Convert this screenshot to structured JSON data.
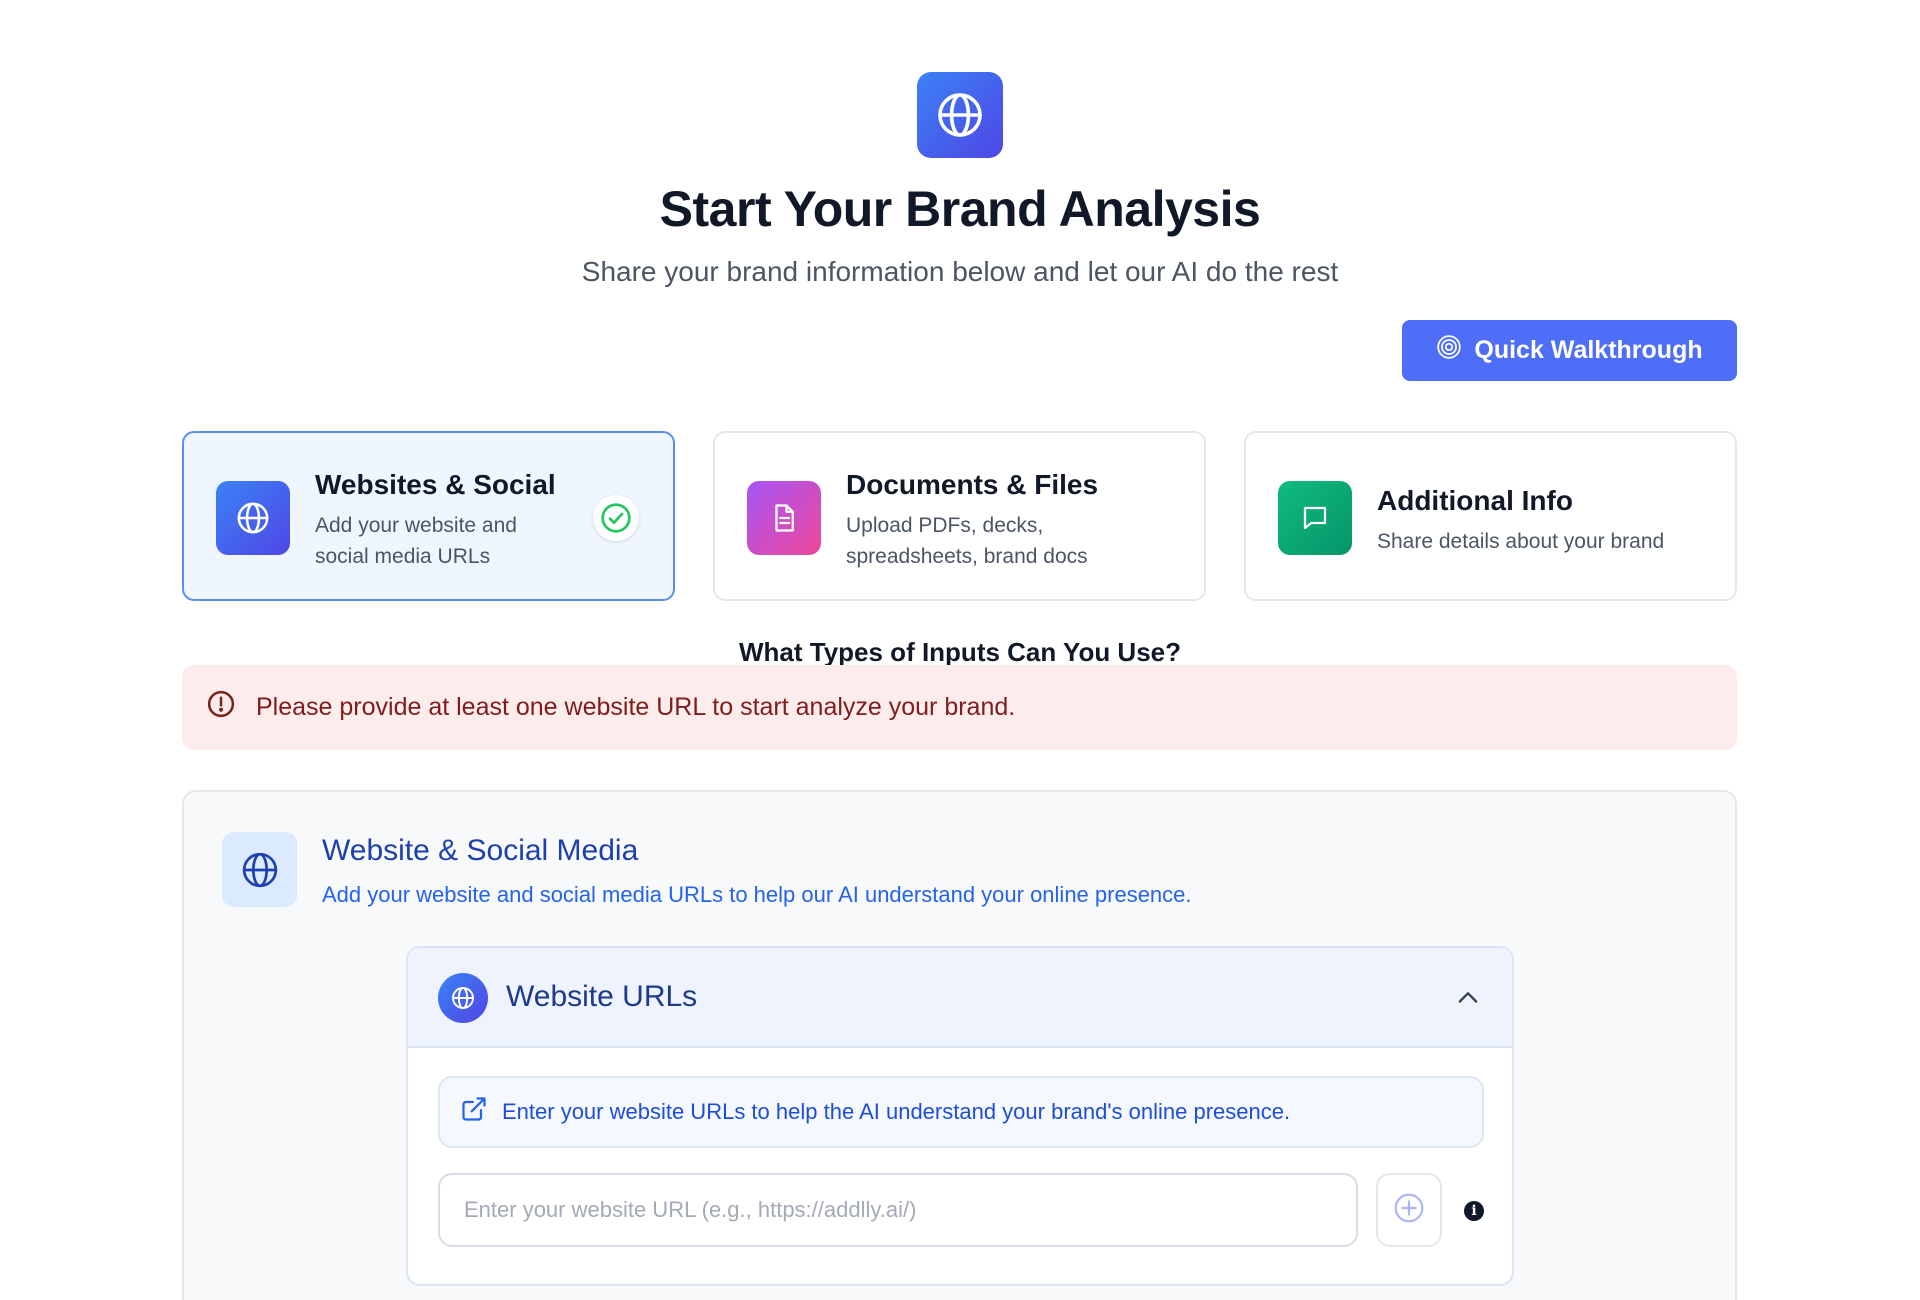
{
  "header": {
    "icon": "globe-icon",
    "title": "Start Your Brand Analysis",
    "subtitle": "Share your brand information below and let our AI do the rest",
    "walkthrough_label": "Quick Walkthrough",
    "walkthrough_icon": "target-icon"
  },
  "steps": [
    {
      "title": "Websites & Social",
      "desc_line1": "Add your website and",
      "desc_line2": "social media URLs",
      "icon": "globe-icon",
      "active": true,
      "completed": true
    },
    {
      "title": "Documents & Files",
      "desc_line1": "Upload PDFs, decks,",
      "desc_line2": "spreadsheets, brand docs",
      "icon": "document-icon",
      "active": false
    },
    {
      "title": "Additional Info",
      "desc_line1": "Share details about your brand",
      "icon": "chat-icon",
      "active": false
    }
  ],
  "inputs_heading": "What Types of Inputs Can You Use?",
  "alert": {
    "text": "Please provide at least one website URL to start analyze your brand.",
    "icon": "alert-circle-icon"
  },
  "section": {
    "title": "Website & Social Media",
    "desc": "Add your website and social media URLs to help our AI understand your online presence.",
    "urls_panel": {
      "title": "Website URLs",
      "hint": "Enter your website URLs to help the AI understand your brand's online presence.",
      "input_value": "",
      "input_placeholder": "Enter your website URL (e.g., https://addlly.ai/)",
      "info_glyph": "i"
    }
  },
  "colors": {
    "primary": "#4f6ef7",
    "active_card_bg": "#f0f6ff",
    "alert_bg": "#fdecec",
    "success": "#22c55e",
    "docs_gradient": [
      "#a855f7",
      "#ec4899"
    ],
    "info_gradient": [
      "#10b981",
      "#059669"
    ]
  }
}
